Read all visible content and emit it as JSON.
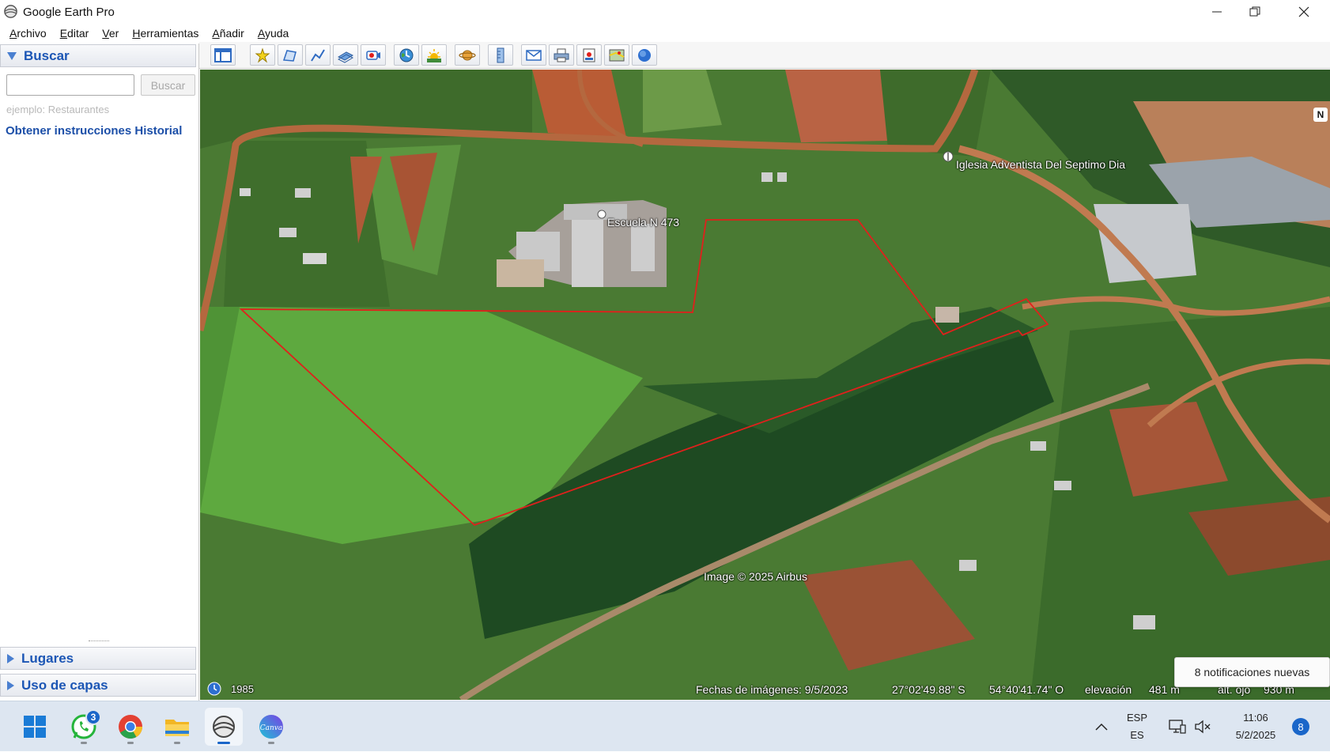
{
  "window": {
    "title": "Google Earth Pro"
  },
  "menu": {
    "items": [
      "Archivo",
      "Editar",
      "Ver",
      "Herramientas",
      "Añadir",
      "Ayuda"
    ]
  },
  "search": {
    "header": "Buscar",
    "input_value": "",
    "button_label": "Buscar",
    "example": "ejemplo: Restaurantes",
    "link_directions": "Obtener instrucciones",
    "link_history": "Historial"
  },
  "places": {
    "header": "Lugares"
  },
  "layers": {
    "header": "Uso de capas"
  },
  "toolbar": {
    "icons": [
      "sidebar-toggle-icon",
      "placemark-icon",
      "polygon-icon",
      "path-icon",
      "image-overlay-icon",
      "record-tour-icon",
      "historical-imagery-icon",
      "sunlight-icon",
      "planets-icon",
      "ruler-icon",
      "email-icon",
      "print-icon",
      "save-image-icon",
      "view-in-maps-icon",
      "earth-icon"
    ]
  },
  "map": {
    "labels": {
      "school": "Escuela N 473",
      "church": "Iglesia Adventista Del Septimo Dia"
    },
    "copyright": "Image © 2025 Airbus",
    "year": "1985",
    "imagery_date": "Fechas de imágenes: 9/5/2023",
    "latitude": "27°02'49.88\" S",
    "longitude": "54°40'41.74\" O",
    "elevation_label": "elevación",
    "elevation": "481 m",
    "eye_alt_label": "alt. ojo",
    "eye_alt": "930 m",
    "compass_letter": "N",
    "polygon_color": "#e0201c"
  },
  "notification_toast": "8 notificaciones nuevas",
  "taskbar": {
    "whatsapp_badge": "3",
    "language_top": "ESP",
    "language_bottom": "ES",
    "time": "11:06",
    "date": "5/2/2025",
    "notification_count": "8"
  }
}
